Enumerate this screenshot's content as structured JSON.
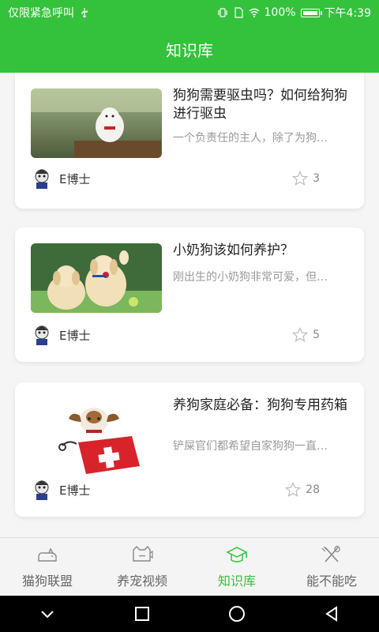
{
  "status": {
    "carrier": "仅限紧急呼叫",
    "battery": "100%",
    "time": "下午4:39"
  },
  "header": {
    "title": "知识库"
  },
  "articles": [
    {
      "title": "狗狗需要驱虫吗？如何给狗狗进行驱虫",
      "summary": "一个负责任的主人，除了为狗…",
      "author": "E博士",
      "likes": "3"
    },
    {
      "title": "小奶狗该如何养护？",
      "summary": "刚出生的小奶狗非常可爱，但…",
      "author": "E博士",
      "likes": "5"
    },
    {
      "title": "养狗家庭必备：狗狗专用药箱",
      "summary": "铲屎官们都希望自家狗狗一直…",
      "author": "E博士",
      "likes": "28"
    }
  ],
  "nav": [
    {
      "label": "猫狗联盟",
      "icon": "cat-dog-icon"
    },
    {
      "label": "养宠视频",
      "icon": "video-icon"
    },
    {
      "label": "知识库",
      "icon": "graduation-cap-icon",
      "active": true
    },
    {
      "label": "能不能吃",
      "icon": "fork-knife-icon"
    }
  ],
  "colors": {
    "accent": "#34c23c"
  }
}
